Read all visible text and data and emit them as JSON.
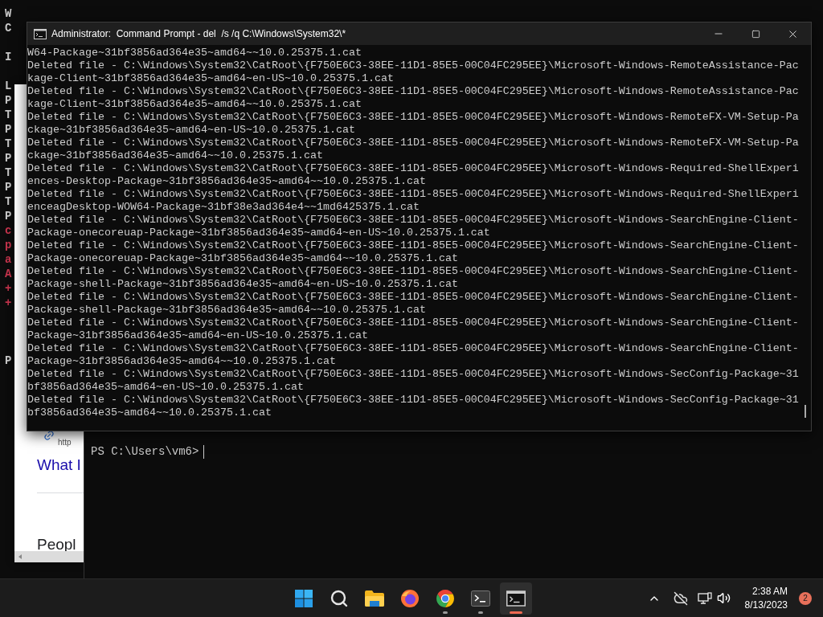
{
  "background_console": {
    "left_column": [
      {
        "kind": "output",
        "text": "W"
      },
      {
        "kind": "output",
        "text": "C"
      },
      {
        "kind": "blank"
      },
      {
        "kind": "output",
        "text": "I"
      },
      {
        "kind": "blank"
      },
      {
        "kind": "output",
        "text": "L"
      },
      {
        "kind": "output",
        "text": "P"
      },
      {
        "kind": "output",
        "text": "T"
      },
      {
        "kind": "output",
        "text": "P"
      },
      {
        "kind": "output",
        "text": "T"
      },
      {
        "kind": "output",
        "text": "P"
      },
      {
        "kind": "output",
        "text": "T"
      },
      {
        "kind": "output",
        "text": "P"
      },
      {
        "kind": "output",
        "text": "T"
      },
      {
        "kind": "output",
        "text": "P"
      },
      {
        "kind": "error",
        "text": "c"
      },
      {
        "kind": "error",
        "text": "p"
      },
      {
        "kind": "error",
        "text": "a"
      },
      {
        "kind": "error",
        "text": "A"
      },
      {
        "kind": "error",
        "text": "+"
      },
      {
        "kind": "error",
        "text": "+"
      },
      {
        "kind": "blank"
      },
      {
        "kind": "blank"
      },
      {
        "kind": "blank"
      },
      {
        "kind": "output",
        "text": "P"
      }
    ],
    "prompt": "PS C:\\Users\\vm6>"
  },
  "browser": {
    "url_text": "http",
    "link": "What I",
    "heading": "Peopl"
  },
  "cmd_window": {
    "title": "Administrator:  Command Prompt - del  /s /q C:\\Windows\\System32\\*",
    "lines": [
      "W64-Package~31bf3856ad364e35~amd64~~10.0.25375.1.cat",
      "Deleted file - C:\\Windows\\System32\\CatRoot\\{F750E6C3-38EE-11D1-85E5-00C04FC295EE}\\Microsoft-Windows-RemoteAssistance-Pac",
      "kage-Client~31bf3856ad364e35~amd64~en-US~10.0.25375.1.cat",
      "Deleted file - C:\\Windows\\System32\\CatRoot\\{F750E6C3-38EE-11D1-85E5-00C04FC295EE}\\Microsoft-Windows-RemoteAssistance-Pac",
      "kage-Client~31bf3856ad364e35~amd64~~10.0.25375.1.cat",
      "Deleted file - C:\\Windows\\System32\\CatRoot\\{F750E6C3-38EE-11D1-85E5-00C04FC295EE}\\Microsoft-Windows-RemoteFX-VM-Setup-Pa",
      "ckage~31bf3856ad364e35~amd64~en-US~10.0.25375.1.cat",
      "Deleted file - C:\\Windows\\System32\\CatRoot\\{F750E6C3-38EE-11D1-85E5-00C04FC295EE}\\Microsoft-Windows-RemoteFX-VM-Setup-Pa",
      "ckage~31bf3856ad364e35~amd64~~10.0.25375.1.cat",
      "Deleted file - C:\\Windows\\System32\\CatRoot\\{F750E6C3-38EE-11D1-85E5-00C04FC295EE}\\Microsoft-Windows-Required-ShellExperi",
      "ences-Desktop-Package~31bf3856ad364e35~amd64~~10.0.25375.1.cat",
      "Deleted file - C:\\Windows\\System32\\CatRoot\\{F750E6C3-38EE-11D1-85E5-00C04FC295EE}\\Microsoft-Windows-Required-ShellExperi",
      "enceagDesktop-WOW64-Package~31bf38e3ad364e4~~1md6425375.1.cat",
      "Deleted file - C:\\Windows\\System32\\CatRoot\\{F750E6C3-38EE-11D1-85E5-00C04FC295EE}\\Microsoft-Windows-SearchEngine-Client-",
      "Package-onecoreuap-Package~31bf3856ad364e35~amd64~en-US~10.0.25375.1.cat",
      "Deleted file - C:\\Windows\\System32\\CatRoot\\{F750E6C3-38EE-11D1-85E5-00C04FC295EE}\\Microsoft-Windows-SearchEngine-Client-",
      "Package-onecoreuap-Package~31bf3856ad364e35~amd64~~10.0.25375.1.cat",
      "Deleted file - C:\\Windows\\System32\\CatRoot\\{F750E6C3-38EE-11D1-85E5-00C04FC295EE}\\Microsoft-Windows-SearchEngine-Client-",
      "Package-shell-Package~31bf3856ad364e35~amd64~en-US~10.0.25375.1.cat",
      "Deleted file - C:\\Windows\\System32\\CatRoot\\{F750E6C3-38EE-11D1-85E5-00C04FC295EE}\\Microsoft-Windows-SearchEngine-Client-",
      "Package-shell-Package~31bf3856ad364e35~amd64~~10.0.25375.1.cat",
      "Deleted file - C:\\Windows\\System32\\CatRoot\\{F750E6C3-38EE-11D1-85E5-00C04FC295EE}\\Microsoft-Windows-SearchEngine-Client-",
      "Package~31bf3856ad364e35~amd64~en-US~10.0.25375.1.cat",
      "Deleted file - C:\\Windows\\System32\\CatRoot\\{F750E6C3-38EE-11D1-85E5-00C04FC295EE}\\Microsoft-Windows-SearchEngine-Client-",
      "Package~31bf3856ad364e35~amd64~~10.0.25375.1.cat",
      "Deleted file - C:\\Windows\\System32\\CatRoot\\{F750E6C3-38EE-11D1-85E5-00C04FC295EE}\\Microsoft-Windows-SecConfig-Package~31",
      "bf3856ad364e35~amd64~en-US~10.0.25375.1.cat",
      "Deleted file - C:\\Windows\\System32\\CatRoot\\{F750E6C3-38EE-11D1-85E5-00C04FC295EE}\\Microsoft-Windows-SecConfig-Package~31",
      "bf3856ad364e35~amd64~~10.0.25375.1.cat"
    ]
  },
  "taskbar": {
    "apps": [
      {
        "kind": "start",
        "running": false,
        "selected": false
      },
      {
        "kind": "search",
        "running": false,
        "selected": false
      },
      {
        "kind": "files",
        "running": false,
        "selected": false
      },
      {
        "kind": "firefox",
        "running": false,
        "selected": false
      },
      {
        "kind": "chrome",
        "running": true,
        "selected": false
      },
      {
        "kind": "terminal",
        "running": true,
        "selected": false
      },
      {
        "kind": "cmd",
        "running": true,
        "selected": true
      }
    ],
    "tray": {
      "time": "2:38 AM",
      "date": "8/13/2023",
      "notifications": "2"
    }
  }
}
